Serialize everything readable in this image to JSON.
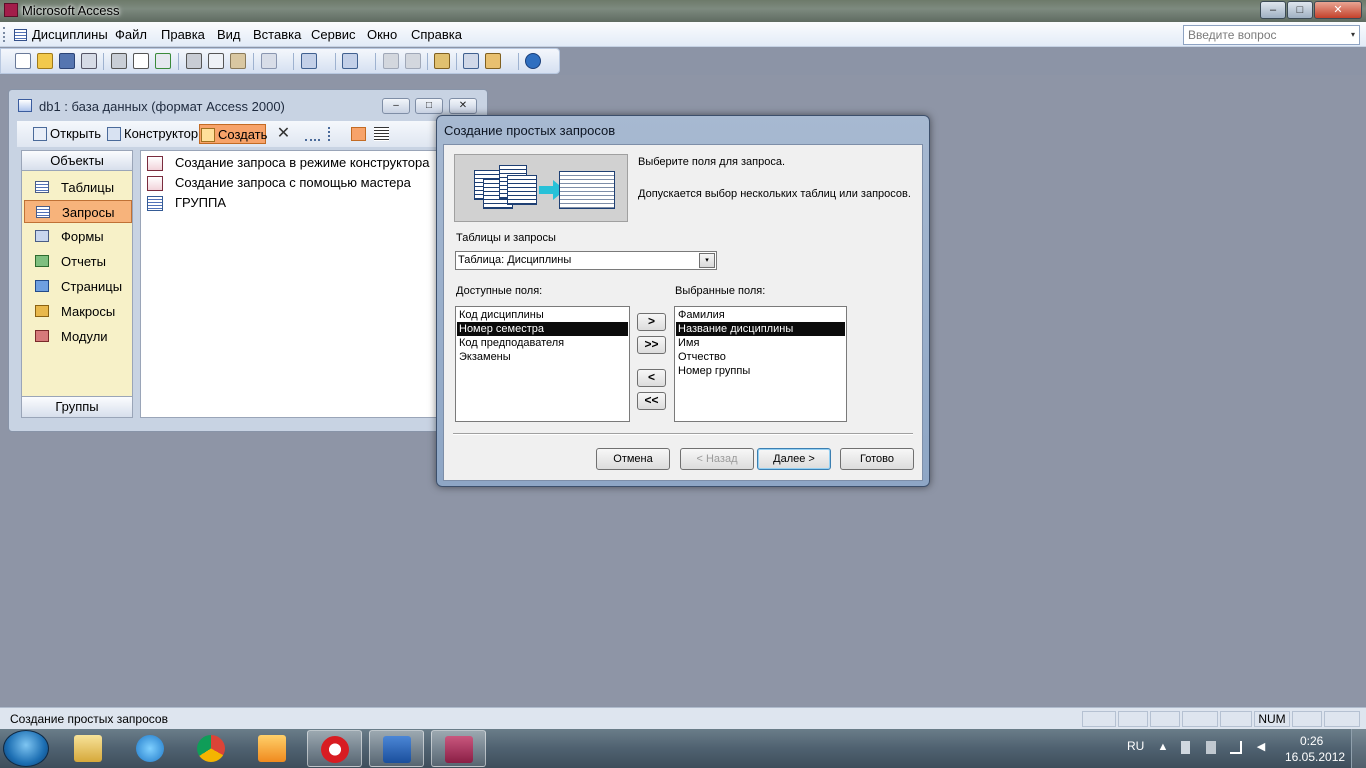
{
  "window": {
    "title": "Microsoft Access",
    "min_glyph": "–",
    "max_glyph": "□",
    "close_glyph": "✕"
  },
  "menu": {
    "items": [
      "Дисциплины",
      "Файл",
      "Правка",
      "Вид",
      "Вставка",
      "Сервис",
      "Окно",
      "Справка"
    ],
    "help_placeholder": "Введите вопрос",
    "dropdown_glyph": "▾"
  },
  "db_window": {
    "title": "db1 : база данных (формат Access 2000)",
    "toolbar": {
      "open": "Открыть",
      "design": "Конструктор",
      "create": "Создать",
      "delete_glyph": "✕"
    },
    "objects_header": "Объекты",
    "groups_footer": "Группы",
    "objects": [
      "Таблицы",
      "Запросы",
      "Формы",
      "Отчеты",
      "Страницы",
      "Макросы",
      "Модули"
    ],
    "selected_object": "Запросы",
    "list": [
      "Создание запроса в режиме конструктора",
      "Создание запроса с помощью мастера",
      "ГРУППА"
    ]
  },
  "wizard": {
    "title": "Создание простых запросов",
    "heading": "Выберите поля для запроса.",
    "subtext": "Допускается выбор нескольких таблиц или запросов.",
    "tables_label": "Таблицы и запросы",
    "tables_value": "Таблица: Дисциплины",
    "available_label": "Доступные поля:",
    "selected_label": "Выбранные поля:",
    "available_fields": [
      "Код дисциплины",
      "Номер семестра",
      "Код предподавателя",
      "Экзамены"
    ],
    "available_highlight": "Номер семестра",
    "selected_fields": [
      "Фамилия",
      "Название дисциплины",
      "Имя",
      "Отчество",
      "Номер группы"
    ],
    "selected_highlight": "Название дисциплины",
    "move_buttons": [
      ">",
      ">>",
      "<",
      "<<"
    ],
    "buttons": {
      "cancel": "Отмена",
      "back": "< Назад",
      "next": "Далее >",
      "finish": "Готово"
    }
  },
  "status": {
    "text": "Создание простых запросов",
    "num": "NUM"
  },
  "taskbar": {
    "lang": "RU",
    "time": "0:26",
    "date": "16.05.2012"
  }
}
